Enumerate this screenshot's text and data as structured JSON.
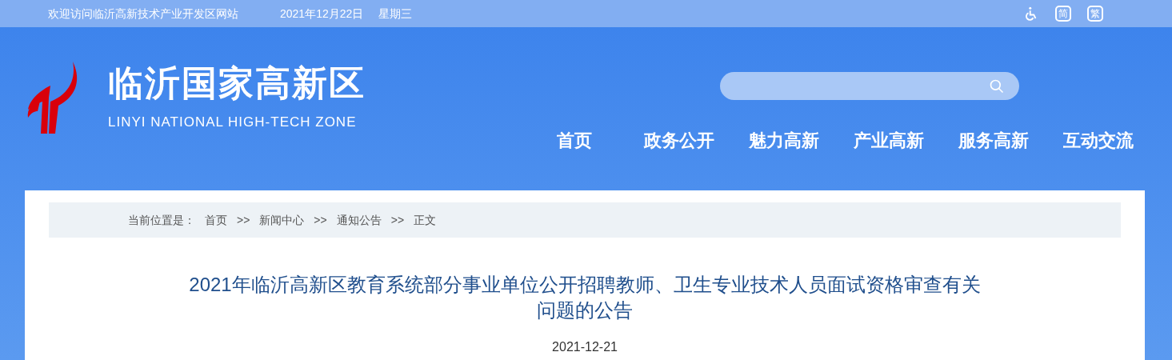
{
  "top_bar": {
    "welcome": "欢迎访问临沂高新技术产业开发区网站",
    "date": "2021年12月22日",
    "weekday": "星期三",
    "language_buttons": [
      "简",
      "繁"
    ]
  },
  "header": {
    "site_name": "临沂国家高新区",
    "site_name_en": "LINYI NATIONAL HIGH-TECH ZONE"
  },
  "nav": [
    "首页",
    "政务公开",
    "魅力高新",
    "产业高新",
    "服务高新",
    "互动交流"
  ],
  "breadcrumb": {
    "label": "当前位置是：",
    "entries": [
      {
        "kind": "link",
        "text": "首页"
      },
      {
        "kind": "sep",
        "text": ">>"
      },
      {
        "kind": "link",
        "text": "新闻中心"
      },
      {
        "kind": "sep",
        "text": ">>"
      },
      {
        "kind": "link",
        "text": "通知公告"
      },
      {
        "kind": "sep",
        "text": ">>"
      },
      {
        "kind": "current",
        "text": "正文"
      }
    ]
  },
  "article": {
    "title": "2021年临沂高新区教育系统部分事业单位公开招聘教师、卫生专业技术人员面试资格审查有关问题的公告",
    "date": "2021-12-21"
  }
}
